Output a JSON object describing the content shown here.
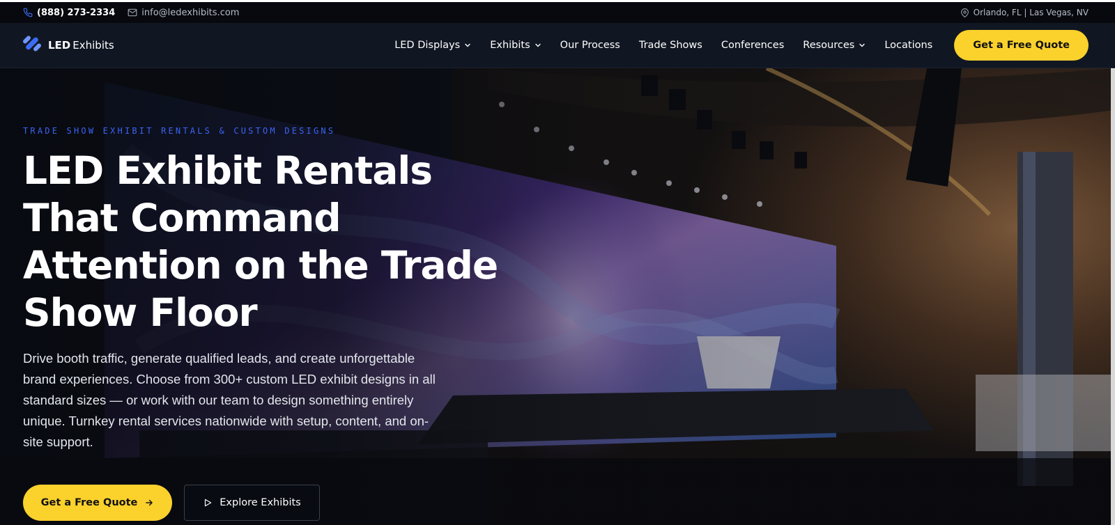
{
  "topbar": {
    "phone": "(888) 273-2334",
    "email": "info@ledexhibits.com",
    "location": "Orlando, FL | Las Vegas, NV",
    "icons": {
      "phone": "phone-icon",
      "email": "mail-icon",
      "location": "map-pin-icon"
    }
  },
  "header": {
    "logo_strong": "LED",
    "logo_rest": "Exhibits",
    "nav": [
      {
        "label": "LED Displays",
        "dropdown": true
      },
      {
        "label": "Exhibits",
        "dropdown": true
      },
      {
        "label": "Our Process",
        "dropdown": false
      },
      {
        "label": "Trade Shows",
        "dropdown": false
      },
      {
        "label": "Conferences",
        "dropdown": false
      },
      {
        "label": "Resources",
        "dropdown": true
      },
      {
        "label": "Locations",
        "dropdown": false
      }
    ],
    "cta": "Get a Free Quote"
  },
  "hero": {
    "eyebrow": "TRADE SHOW EXHIBIT RENTALS & CUSTOM DESIGNS",
    "headline_lines": [
      "LED Exhibit Rentals",
      "That Command",
      "Attention on the Trade",
      "Show Floor"
    ],
    "subtext": "Drive booth traffic, generate qualified leads, and create unforgettable brand experiences. Choose from 300+ custom LED exhibit designs in all standard sizes — or work with our team to design something entirely unique. Turnkey rental services nationwide with setup, content, and on-site support.",
    "primary_cta": "Get a Free Quote",
    "secondary_cta": "Explore Exhibits"
  },
  "colors": {
    "accent_yellow": "#fbd12c",
    "eyebrow_blue": "#3b63f5",
    "nav_bg": "#111722",
    "topbar_bg": "#07090e",
    "logo_blue": "#3b6cf6"
  }
}
